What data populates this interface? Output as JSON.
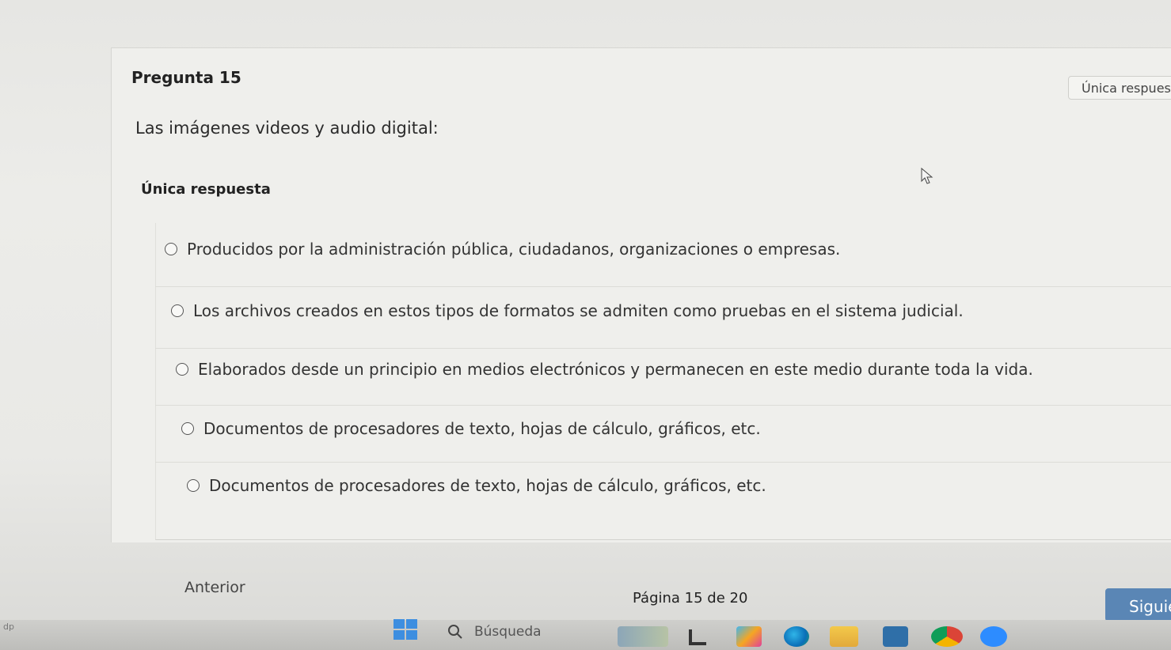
{
  "question": {
    "title": "Pregunta 15",
    "type_badge": "Única respuesta",
    "text": "Las imágenes videos y audio digital:",
    "answer_type_label": "Única respuesta",
    "options": [
      {
        "label": "Producidos por la administración pública, ciudadanos, organizaciones o empresas."
      },
      {
        "label": "Los archivos creados en estos tipos de formatos se admiten como pruebas en el sistema judicial."
      },
      {
        "label": "Elaborados desde un principio en medios electrónicos y permanecen en este medio durante toda la vida."
      },
      {
        "label": "Documentos de procesadores de texto, hojas de cálculo, gráficos, etc."
      },
      {
        "label": "Documentos de procesadores de texto, hojas de cálculo, gráficos, etc."
      }
    ]
  },
  "navigation": {
    "prev_label": "Anterior",
    "page_indicator": "Página 15 de 20",
    "next_label": "Siguiente"
  },
  "taskbar": {
    "left_label": "dp",
    "search_label": "Búsqueda",
    "apps": [
      {
        "icon": "weather-widget-icon"
      },
      {
        "icon": "file-explorer-icon"
      },
      {
        "icon": "copilot-icon"
      },
      {
        "icon": "edge-browser-icon"
      },
      {
        "icon": "folder-icon"
      },
      {
        "icon": "store-icon"
      },
      {
        "icon": "chrome-icon"
      },
      {
        "icon": "zoom-app-icon"
      }
    ]
  },
  "colors": {
    "accent_button": "#5a86b5",
    "windows_blue": "#3d8ee0"
  }
}
